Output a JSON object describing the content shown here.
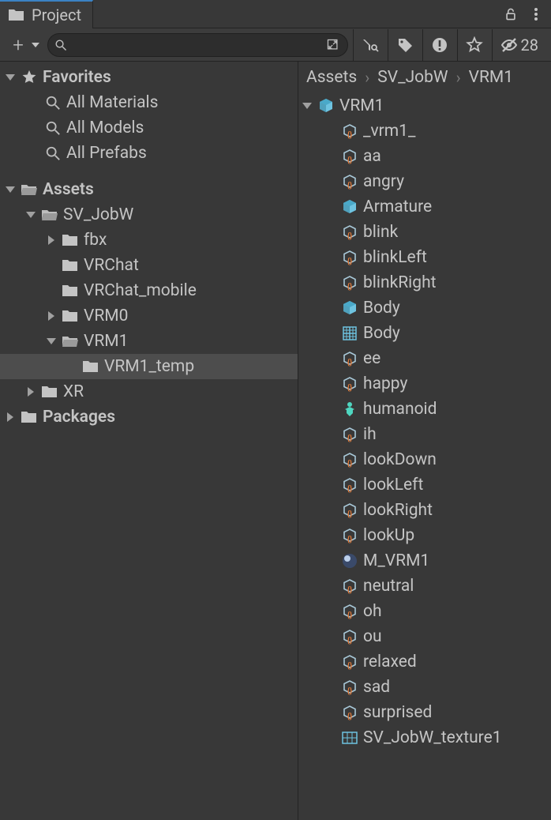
{
  "tab": {
    "title": "Project"
  },
  "toolbar": {
    "search_placeholder": "",
    "hidden_count": "28"
  },
  "breadcrumb": [
    "Assets",
    "SV_JobW",
    "VRM1"
  ],
  "favorites": {
    "label": "Favorites",
    "items": [
      "All Materials",
      "All Models",
      "All Prefabs"
    ]
  },
  "tree": {
    "assets_label": "Assets",
    "packages_label": "Packages",
    "sv_jobw": {
      "label": "SV_JobW",
      "children": {
        "fbx": "fbx",
        "vrchat": "VRChat",
        "vrchat_mobile": "VRChat_mobile",
        "vrm0": "VRM0",
        "vrm1": "VRM1",
        "vrm1_temp": "VRM1_temp"
      }
    },
    "xr": "XR"
  },
  "content": {
    "root": {
      "label": "VRM1",
      "icon": "prefab"
    },
    "items": [
      {
        "label": "_vrm1_",
        "icon": "scriptable"
      },
      {
        "label": "aa",
        "icon": "scriptable"
      },
      {
        "label": "angry",
        "icon": "scriptable"
      },
      {
        "label": "Armature",
        "icon": "prefab"
      },
      {
        "label": "blink",
        "icon": "scriptable"
      },
      {
        "label": "blinkLeft",
        "icon": "scriptable"
      },
      {
        "label": "blinkRight",
        "icon": "scriptable"
      },
      {
        "label": "Body",
        "icon": "prefab"
      },
      {
        "label": "Body",
        "icon": "mesh"
      },
      {
        "label": "ee",
        "icon": "scriptable"
      },
      {
        "label": "happy",
        "icon": "scriptable"
      },
      {
        "label": "humanoid",
        "icon": "avatar"
      },
      {
        "label": "ih",
        "icon": "scriptable"
      },
      {
        "label": "lookDown",
        "icon": "scriptable"
      },
      {
        "label": "lookLeft",
        "icon": "scriptable"
      },
      {
        "label": "lookRight",
        "icon": "scriptable"
      },
      {
        "label": "lookUp",
        "icon": "scriptable"
      },
      {
        "label": "M_VRM1",
        "icon": "material"
      },
      {
        "label": "neutral",
        "icon": "scriptable"
      },
      {
        "label": "oh",
        "icon": "scriptable"
      },
      {
        "label": "ou",
        "icon": "scriptable"
      },
      {
        "label": "relaxed",
        "icon": "scriptable"
      },
      {
        "label": "sad",
        "icon": "scriptable"
      },
      {
        "label": "surprised",
        "icon": "scriptable"
      },
      {
        "label": "SV_JobW_texture1",
        "icon": "texture"
      }
    ]
  }
}
